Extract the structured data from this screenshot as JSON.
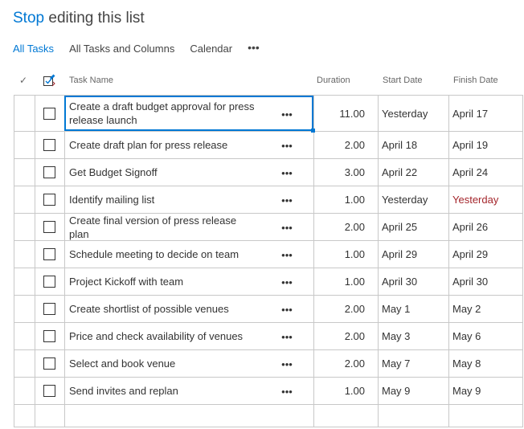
{
  "header": {
    "stop_label": "Stop",
    "title_rest": "editing this list"
  },
  "views": [
    {
      "label": "All Tasks",
      "active": true
    },
    {
      "label": "All Tasks and Columns",
      "active": false
    },
    {
      "label": "Calendar",
      "active": false
    }
  ],
  "view_more_label": "•••",
  "columns": {
    "check_mark": "✓",
    "task_name": "Task Name",
    "duration": "Duration",
    "start_date": "Start Date",
    "finish_date": "Finish Date"
  },
  "row_more_label": "•••",
  "rows": [
    {
      "name": "Create a draft budget approval for press release launch",
      "duration": "11.00",
      "start": "Yesterday",
      "finish": "April 17",
      "finish_late": false
    },
    {
      "name": "Create draft plan for press release",
      "duration": "2.00",
      "start": "April 18",
      "finish": "April 19",
      "finish_late": false
    },
    {
      "name": "Get Budget Signoff",
      "duration": "3.00",
      "start": "April 22",
      "finish": "April 24",
      "finish_late": false
    },
    {
      "name": "Identify mailing list",
      "duration": "1.00",
      "start": "Yesterday",
      "finish": "Yesterday",
      "finish_late": true
    },
    {
      "name": "Create final version of press release plan",
      "duration": "2.00",
      "start": "April 25",
      "finish": "April 26",
      "finish_late": false
    },
    {
      "name": "Schedule meeting to decide on team",
      "duration": "1.00",
      "start": "April 29",
      "finish": "April 29",
      "finish_late": false
    },
    {
      "name": "Project Kickoff with team",
      "duration": "1.00",
      "start": "April 30",
      "finish": "April 30",
      "finish_late": false
    },
    {
      "name": "Create shortlist of possible venues",
      "duration": "2.00",
      "start": "May 1",
      "finish": "May 2",
      "finish_late": false
    },
    {
      "name": "Price and check availability of venues",
      "duration": "2.00",
      "start": "May 3",
      "finish": "May 6",
      "finish_late": false
    },
    {
      "name": "Select and book venue",
      "duration": "2.00",
      "start": "May 7",
      "finish": "May 8",
      "finish_late": false
    },
    {
      "name": "Send invites and replan",
      "duration": "1.00",
      "start": "May 9",
      "finish": "May 9",
      "finish_late": false
    }
  ],
  "colors": {
    "accent": "#0078d4",
    "late": "#a4262c",
    "grid_line": "#c8c8c8"
  }
}
